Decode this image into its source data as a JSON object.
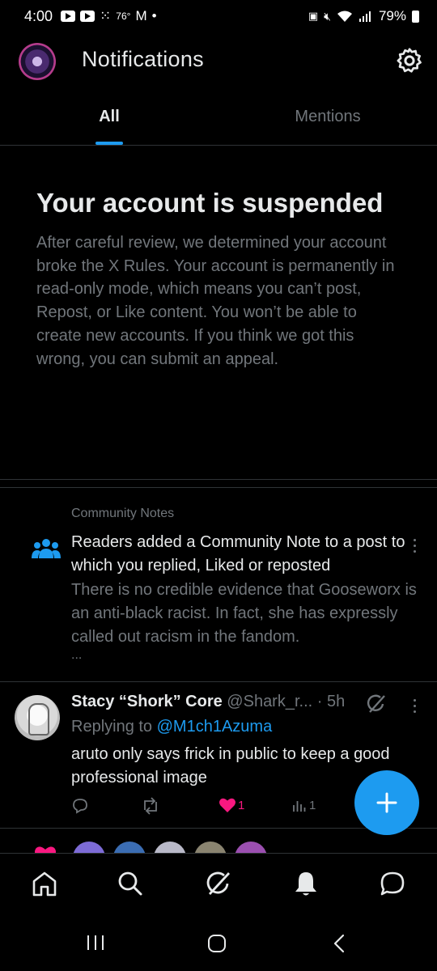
{
  "status_bar": {
    "time": "4:00",
    "temperature": "76°",
    "battery": "79%"
  },
  "header": {
    "title": "Notifications"
  },
  "tabs": [
    {
      "label": "All",
      "active": true
    },
    {
      "label": "Mentions",
      "active": false
    }
  ],
  "suspension": {
    "title": "Your account is suspended",
    "body": "After careful review, we determined your account broke the X Rules. Your account is permanently in read-only mode, which means you can’t post, Repost, or Like content. You won’t be able to create new accounts. If you think we got this wrong, you can submit an appeal."
  },
  "community_note": {
    "label": "Community Notes",
    "text": "Readers added a Community Note to a post to which you replied, Liked or reposted",
    "note": "There is no credible evidence that Gooseworx is an anti-black racist. In fact, she has expressly called out racism in the fandom.",
    "more": "..."
  },
  "tweet": {
    "name": "Stacy “Shork” Core",
    "handle": "@Shark_r...",
    "time": "· 5h",
    "replying_prefix": "Replying to",
    "replying_to": "@M1ch1Azuma",
    "text": "aruto only says frick in public to keep a good professional image",
    "like_count": "1",
    "view_count": "1"
  },
  "icons": {
    "avatar": "profile-avatar",
    "settings": "gear-icon",
    "community": "people-icon",
    "compose": "plus-icon",
    "nav": [
      "home-icon",
      "search-icon",
      "grok-icon",
      "bell-icon",
      "messages-icon"
    ]
  },
  "colors": {
    "accent": "#1d9bf0",
    "like": "#f91880",
    "muted": "#71767b",
    "background": "#000000"
  }
}
